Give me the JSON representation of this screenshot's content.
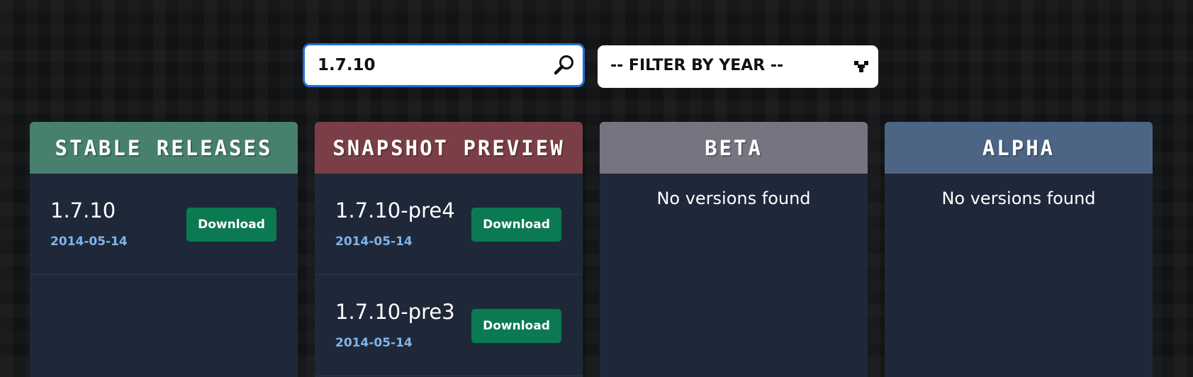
{
  "search": {
    "value": "1.7.10",
    "icon": "search-icon"
  },
  "filter": {
    "label": "-- FILTER BY YEAR --",
    "icon": "chevron-down-icon"
  },
  "colors": {
    "stable": "#47806f",
    "snapshot": "#7a3f46",
    "beta": "#787380",
    "alpha": "#4d6584",
    "download_button": "#0b7a52",
    "date_text": "#7fb3ea",
    "focus_border": "#1f6fd6"
  },
  "columns": {
    "stable": {
      "title": "STABLE RELEASES",
      "items": [
        {
          "name": "1.7.10",
          "date": "2014-05-14",
          "button": "Download"
        }
      ]
    },
    "snapshot": {
      "title": "SNAPSHOT PREVIEW",
      "items": [
        {
          "name": "1.7.10-pre4",
          "date": "2014-05-14",
          "button": "Download"
        },
        {
          "name": "1.7.10-pre3",
          "date": "2014-05-14",
          "button": "Download"
        }
      ]
    },
    "beta": {
      "title": "BETA",
      "empty": "No versions found"
    },
    "alpha": {
      "title": "ALPHA",
      "empty": "No versions found"
    }
  }
}
